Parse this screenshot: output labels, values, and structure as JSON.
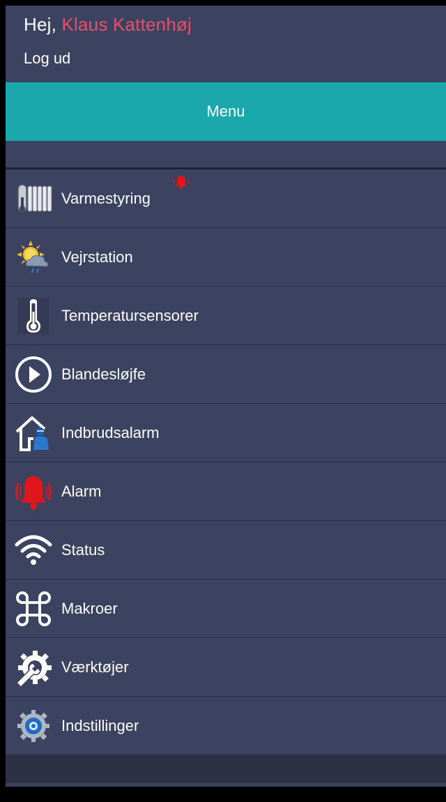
{
  "header": {
    "greeting_prefix": "Hej,",
    "user_name": "Klaus Kattenhøj",
    "logout_label": "Log ud"
  },
  "menu_bar": {
    "label": "Menu"
  },
  "menu_items": [
    {
      "label": "Varmestyring",
      "icon": "radiator-thermometer-icon",
      "alert": true
    },
    {
      "label": "Vejrstation",
      "icon": "weather-sun-cloud-icon"
    },
    {
      "label": "Temperatursensorer",
      "icon": "thermometer-icon"
    },
    {
      "label": "Blandesløjfe",
      "icon": "play-circle-icon"
    },
    {
      "label": "Indbrudsalarm",
      "icon": "house-burglar-icon"
    },
    {
      "label": "Alarm",
      "icon": "alarm-bell-icon"
    },
    {
      "label": "Status",
      "icon": "wifi-icon"
    },
    {
      "label": "Makroer",
      "icon": "command-key-icon"
    },
    {
      "label": "Værktøjer",
      "icon": "wrench-gear-icon"
    },
    {
      "label": "Indstillinger",
      "icon": "settings-gear-icon"
    }
  ],
  "colors": {
    "background": "#3c4360",
    "menu_bar": "#1aa8ac",
    "user_name": "#e8506a",
    "alert_red": "#e0161b"
  }
}
